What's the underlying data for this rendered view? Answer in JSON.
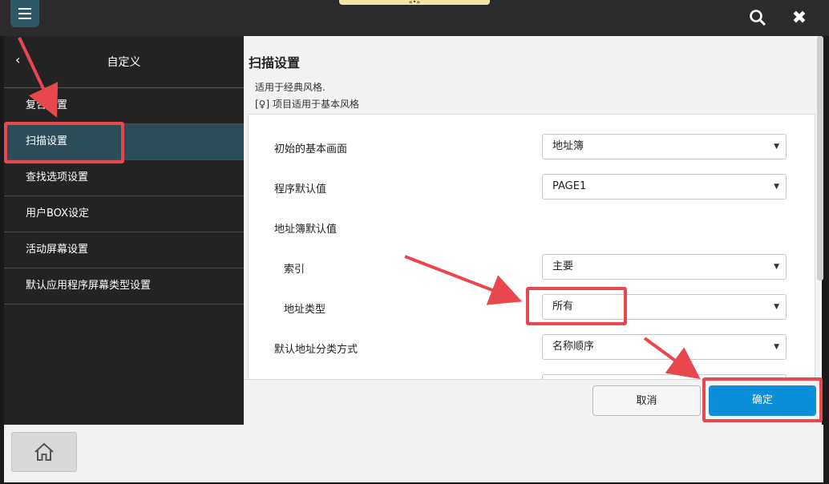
{
  "topbar": {
    "handle": "«•»"
  },
  "sidebar": {
    "title": "自定义",
    "items": [
      {
        "label": "复合设置"
      },
      {
        "label": "扫描设置"
      },
      {
        "label": "查找选项设置"
      },
      {
        "label": "用户BOX设定"
      },
      {
        "label": "活动屏幕设置"
      },
      {
        "label": "默认应用程序屏幕类型设置"
      }
    ]
  },
  "main": {
    "title": "扫描设置",
    "subtitle1": "适用于经典风格.",
    "subtitle2": "[♀] 项目适用于基本风格",
    "settings": [
      {
        "label": "初始的基本画面",
        "value": "地址簿"
      },
      {
        "label": "程序默认值",
        "value": "PAGE1"
      },
      {
        "label": "地址簿默认值"
      },
      {
        "label": "索引",
        "value": "主要"
      },
      {
        "label": "地址类型",
        "value": "所有"
      },
      {
        "label": "默认地址分类方式",
        "value": "名称顺序"
      }
    ],
    "cancel_label": "取消",
    "ok_label": "确定"
  },
  "colors": {
    "accent": "#0a8fd8",
    "sidebar_active": "#2b4d57",
    "annotation": "#e8474e"
  },
  "icons": {
    "menu": "menu-icon",
    "search": "search-icon",
    "close": "close-icon",
    "back": "back-arrow-icon",
    "home": "home-icon"
  }
}
